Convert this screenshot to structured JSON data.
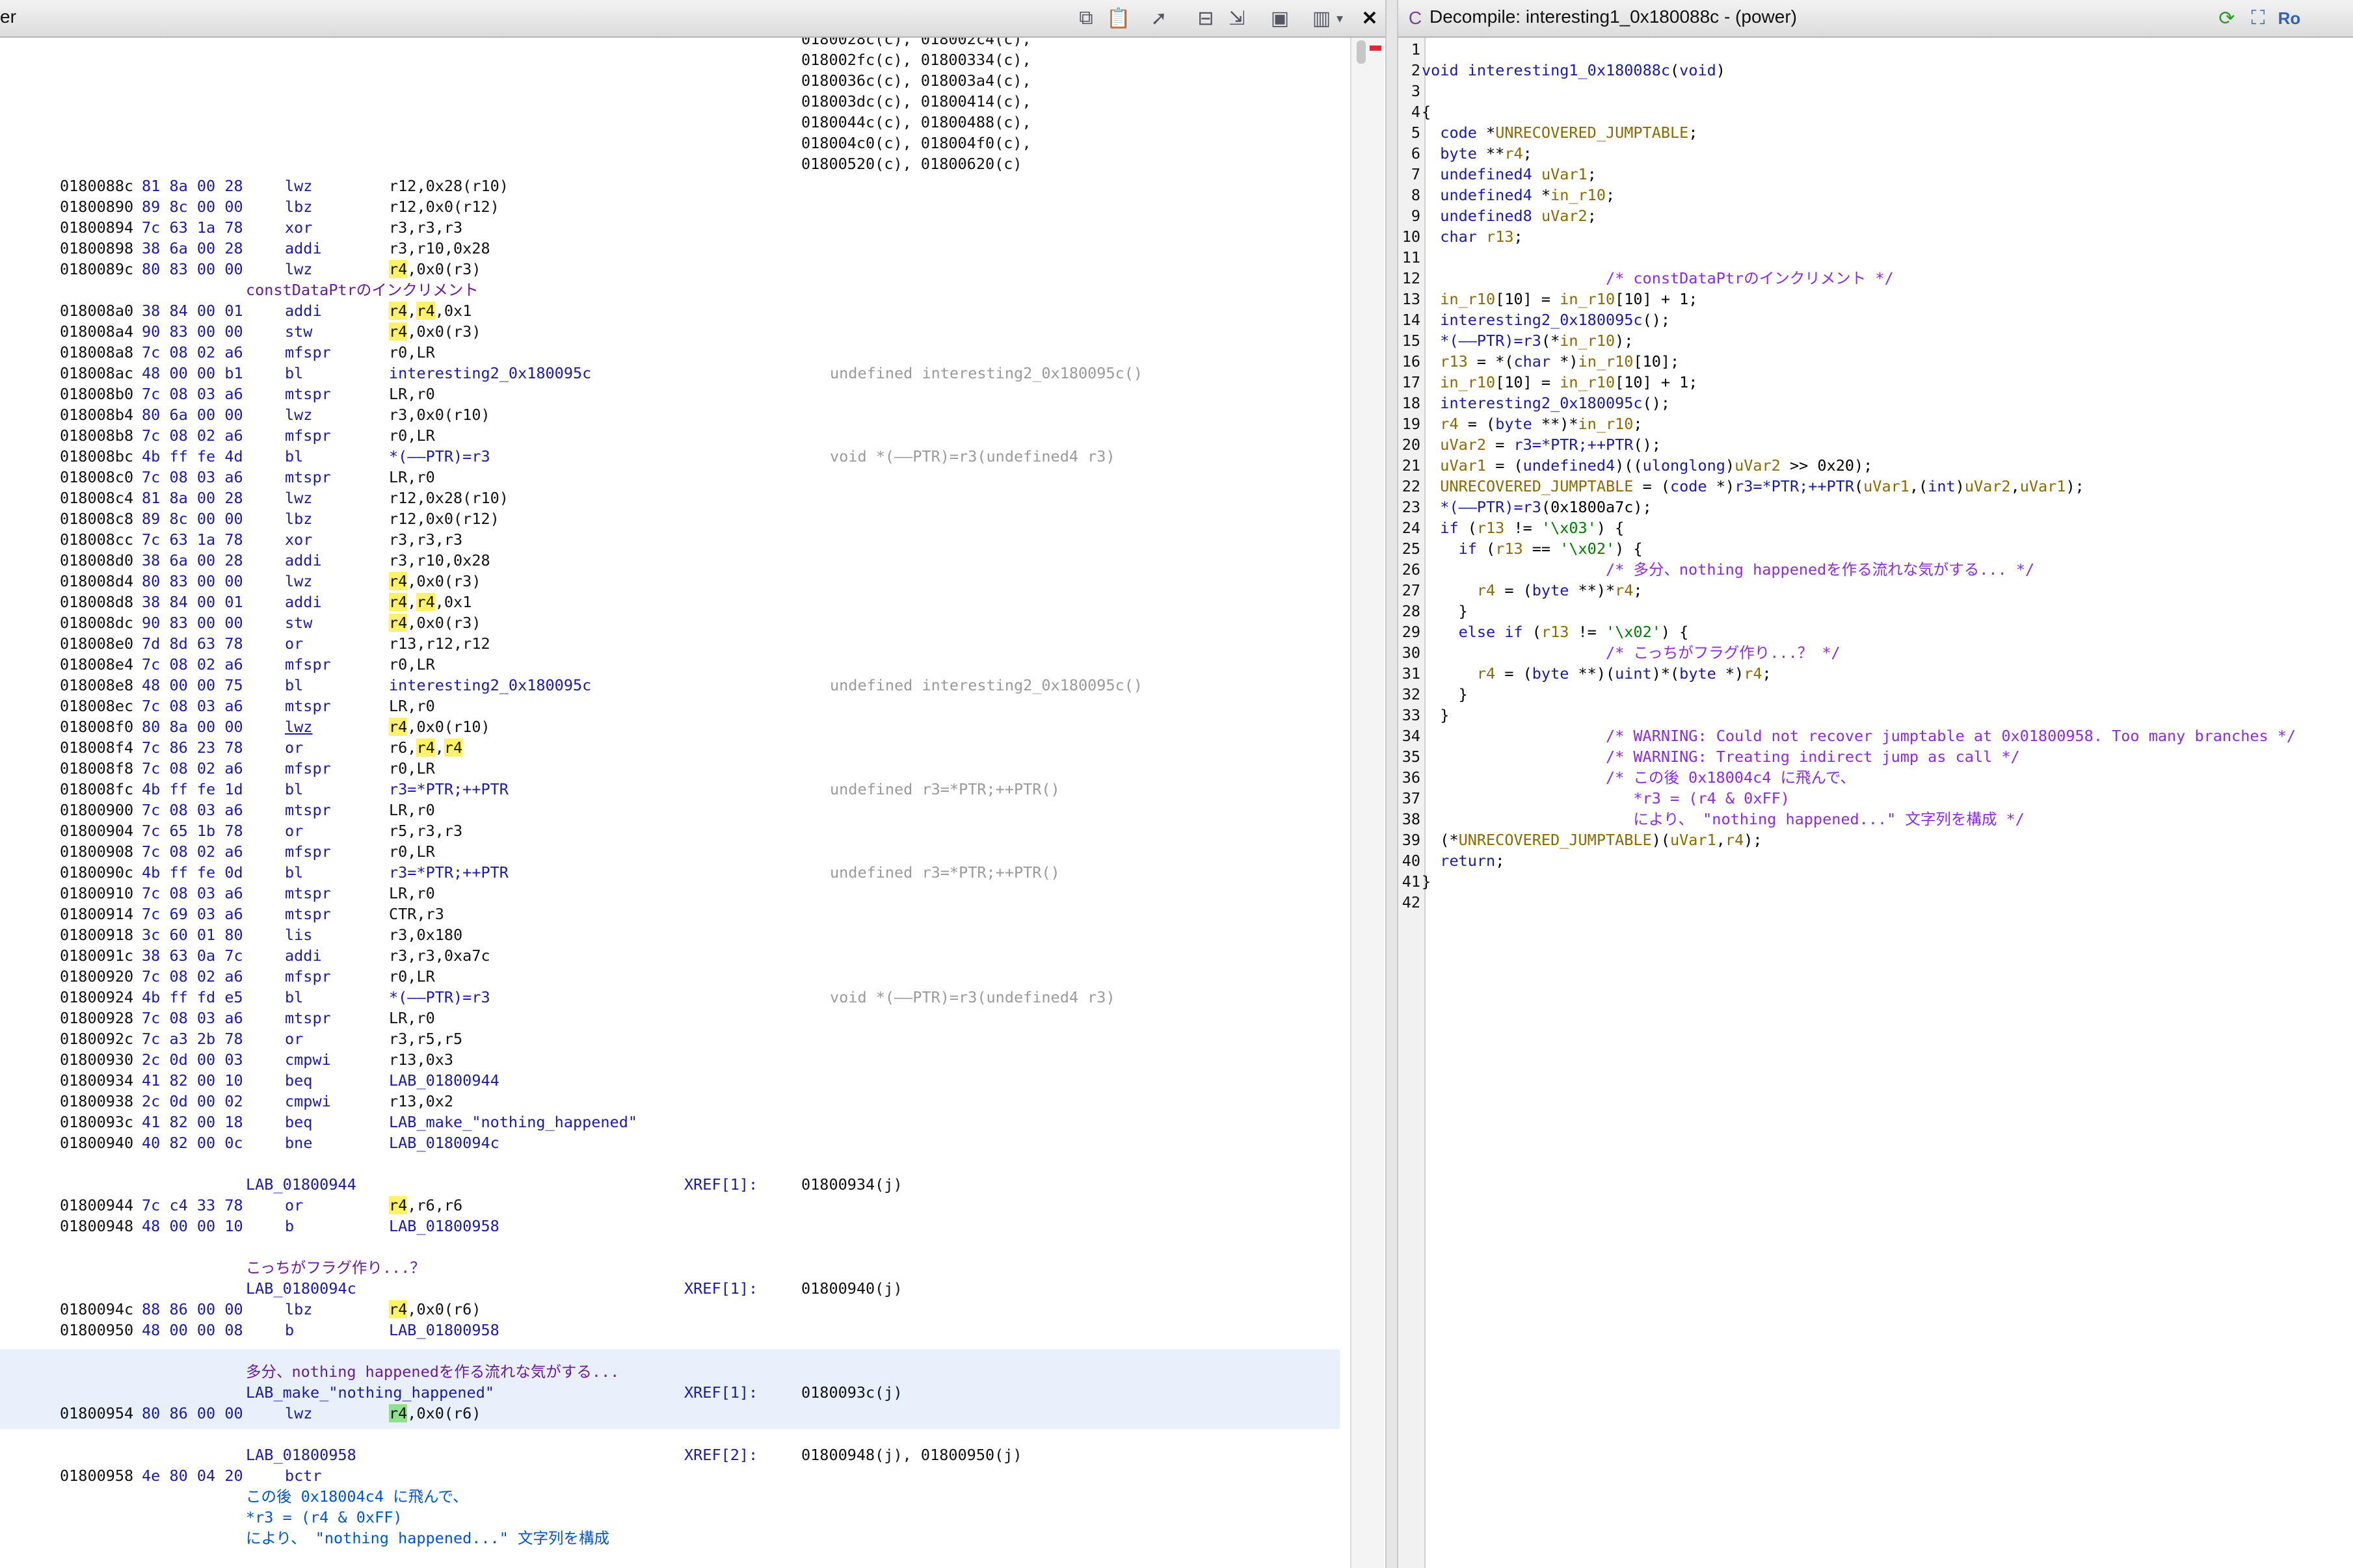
{
  "windows": {
    "listing_title": "er",
    "decompile_title": "Decompile: interesting1_0x180088c -  (power)"
  },
  "listing": {
    "xref_top": [
      "0180028c(c), 018002c4(c),",
      "018002fc(c), 01800334(c),",
      "0180036c(c), 018003a4(c),",
      "018003dc(c), 01800414(c),",
      "0180044c(c), 01800488(c),",
      "018004c0(c), 018004f0(c),",
      "01800520(c), 01800620(c)"
    ],
    "rows": [
      {
        "a": "0180088c",
        "b": "81 8a 00 28",
        "m": "lwz",
        "o": "r12,0x28(r10)"
      },
      {
        "a": "01800890",
        "b": "89 8c 00 00",
        "m": "lbz",
        "o": "r12,0x0(r12)"
      },
      {
        "a": "01800894",
        "b": "7c 63 1a 78",
        "m": "xor",
        "o": "r3,r3,r3"
      },
      {
        "a": "01800898",
        "b": "38 6a 00 28",
        "m": "addi",
        "o": "r3,r10,0x28"
      },
      {
        "a": "0180089c",
        "b": "80 83 00 00",
        "m": "lwz",
        "o": "r4,0x0(r3)"
      },
      {
        "label": "constDataPtrのインクリメント",
        "labelClass": "c-jp"
      },
      {
        "a": "018008a0",
        "b": "38 84 00 01",
        "m": "addi",
        "o": "r4,r4,0x1"
      },
      {
        "a": "018008a4",
        "b": "90 83 00 00",
        "m": "stw",
        "o": "r4,0x0(r3)"
      },
      {
        "a": "018008a8",
        "b": "7c 08 02 a6",
        "m": "mfspr",
        "o": "r0,LR"
      },
      {
        "a": "018008ac",
        "b": "48 00 00 b1",
        "m": "bl",
        "o": "interesting2_0x180095c",
        "c": "undefined interesting2_0x180095c()"
      },
      {
        "a": "018008b0",
        "b": "7c 08 03 a6",
        "m": "mtspr",
        "o": "LR,r0"
      },
      {
        "a": "018008b4",
        "b": "80 6a 00 00",
        "m": "lwz",
        "o": "r3,0x0(r10)"
      },
      {
        "a": "018008b8",
        "b": "7c 08 02 a6",
        "m": "mfspr",
        "o": "r0,LR"
      },
      {
        "a": "018008bc",
        "b": "4b ff fe 4d",
        "m": "bl",
        "o": "*(––PTR)=r3",
        "c": "void *(––PTR)=r3(undefined4 r3)"
      },
      {
        "a": "018008c0",
        "b": "7c 08 03 a6",
        "m": "mtspr",
        "o": "LR,r0"
      },
      {
        "a": "018008c4",
        "b": "81 8a 00 28",
        "m": "lwz",
        "o": "r12,0x28(r10)"
      },
      {
        "a": "018008c8",
        "b": "89 8c 00 00",
        "m": "lbz",
        "o": "r12,0x0(r12)"
      },
      {
        "a": "018008cc",
        "b": "7c 63 1a 78",
        "m": "xor",
        "o": "r3,r3,r3"
      },
      {
        "a": "018008d0",
        "b": "38 6a 00 28",
        "m": "addi",
        "o": "r3,r10,0x28"
      },
      {
        "a": "018008d4",
        "b": "80 83 00 00",
        "m": "lwz",
        "o": "r4,0x0(r3)"
      },
      {
        "a": "018008d8",
        "b": "38 84 00 01",
        "m": "addi",
        "o": "r4,r4,0x1"
      },
      {
        "a": "018008dc",
        "b": "90 83 00 00",
        "m": "stw",
        "o": "r4,0x0(r3)"
      },
      {
        "a": "018008e0",
        "b": "7d 8d 63 78",
        "m": "or",
        "o": "r13,r12,r12"
      },
      {
        "a": "018008e4",
        "b": "7c 08 02 a6",
        "m": "mfspr",
        "o": "r0,LR"
      },
      {
        "a": "018008e8",
        "b": "48 00 00 75",
        "m": "bl",
        "o": "interesting2_0x180095c",
        "c": "undefined interesting2_0x180095c()"
      },
      {
        "a": "018008ec",
        "b": "7c 08 03 a6",
        "m": "mtspr",
        "o": "LR,r0"
      },
      {
        "a": "018008f0",
        "b": "80 8a 00 00",
        "m": "lwz",
        "o": "r4,0x0(r10)"
      },
      {
        "a": "018008f4",
        "b": "7c 86 23 78",
        "m": "or",
        "o": "r6,r4,r4"
      },
      {
        "a": "018008f8",
        "b": "7c 08 02 a6",
        "m": "mfspr",
        "o": "r0,LR"
      },
      {
        "a": "018008fc",
        "b": "4b ff fe 1d",
        "m": "bl",
        "o": "r3=*PTR;++PTR",
        "c": "undefined r3=*PTR;++PTR()"
      },
      {
        "a": "01800900",
        "b": "7c 08 03 a6",
        "m": "mtspr",
        "o": "LR,r0"
      },
      {
        "a": "01800904",
        "b": "7c 65 1b 78",
        "m": "or",
        "o": "r5,r3,r3"
      },
      {
        "a": "01800908",
        "b": "7c 08 02 a6",
        "m": "mfspr",
        "o": "r0,LR"
      },
      {
        "a": "0180090c",
        "b": "4b ff fe 0d",
        "m": "bl",
        "o": "r3=*PTR;++PTR",
        "c": "undefined r3=*PTR;++PTR()"
      },
      {
        "a": "01800910",
        "b": "7c 08 03 a6",
        "m": "mtspr",
        "o": "LR,r0"
      },
      {
        "a": "01800914",
        "b": "7c 69 03 a6",
        "m": "mtspr",
        "o": "CTR,r3"
      },
      {
        "a": "01800918",
        "b": "3c 60 01 80",
        "m": "lis",
        "o": "r3,0x180"
      },
      {
        "a": "0180091c",
        "b": "38 63 0a 7c",
        "m": "addi",
        "o": "r3,r3,0xa7c"
      },
      {
        "a": "01800920",
        "b": "7c 08 02 a6",
        "m": "mfspr",
        "o": "r0,LR"
      },
      {
        "a": "01800924",
        "b": "4b ff fd e5",
        "m": "bl",
        "o": "*(––PTR)=r3",
        "c": "void *(––PTR)=r3(undefined4 r3)"
      },
      {
        "a": "01800928",
        "b": "7c 08 03 a6",
        "m": "mtspr",
        "o": "LR,r0"
      },
      {
        "a": "0180092c",
        "b": "7c a3 2b 78",
        "m": "or",
        "o": "r3,r5,r5"
      },
      {
        "a": "01800930",
        "b": "2c 0d 00 03",
        "m": "cmpwi",
        "o": "r13,0x3"
      },
      {
        "a": "01800934",
        "b": "41 82 00 10",
        "m": "beq",
        "o": "LAB_01800944"
      },
      {
        "a": "01800938",
        "b": "2c 0d 00 02",
        "m": "cmpwi",
        "o": "r13,0x2"
      },
      {
        "a": "0180093c",
        "b": "41 82 00 18",
        "m": "beq",
        "o": "LAB_make_\"nothing_happened\""
      },
      {
        "a": "01800940",
        "b": "40 82 00 0c",
        "m": "bne",
        "o": "LAB_0180094c"
      },
      {
        "blank": true
      },
      {
        "label": "LAB_01800944",
        "labelClass": "c-lbl",
        "xref": "XREF[1]:",
        "xaddr": "01800934(j)"
      },
      {
        "a": "01800944",
        "b": "7c c4 33 78",
        "m": "or",
        "o": "r4,r6,r6"
      },
      {
        "a": "01800948",
        "b": "48 00 00 10",
        "m": "b",
        "o": "LAB_01800958"
      },
      {
        "blank": true
      },
      {
        "label": "こっちがフラグ作り...？",
        "labelClass": "c-jp"
      },
      {
        "label": "LAB_0180094c",
        "labelClass": "c-lbl",
        "xref": "XREF[1]:",
        "xaddr": "01800940(j)"
      },
      {
        "a": "0180094c",
        "b": "88 86 00 00",
        "m": "lbz",
        "o": "r4,0x0(r6)"
      },
      {
        "a": "01800950",
        "b": "48 00 00 08",
        "m": "b",
        "o": "LAB_01800958"
      },
      {
        "blank": true
      },
      {
        "label": "多分、nothing happenedを作る流れな気がする...",
        "labelClass": "c-jp"
      },
      {
        "label": "LAB_make_\"nothing_happened\"",
        "labelClass": "c-lbl",
        "xref": "XREF[1]:",
        "xaddr": "0180093c(j)"
      },
      {
        "a": "01800954",
        "b": "80 86 00 00",
        "m": "lwz",
        "o": "r4,0x0(r6)"
      },
      {
        "blank": true
      },
      {
        "label": "LAB_01800958",
        "labelClass": "c-lbl",
        "xref": "XREF[2]:",
        "xaddr": "01800948(j), 01800950(j)"
      },
      {
        "a": "01800958",
        "b": "4e 80 04 20",
        "m": "bctr",
        "o": ""
      },
      {
        "label": "この後 0x18004c4 に飛んで、",
        "labelClass": "c-blue"
      },
      {
        "label": "*r3 = (r4 & 0xFF)",
        "labelClass": "c-blue"
      },
      {
        "label": "により、 \"nothing happened...\" 文字列を構成",
        "labelClass": "c-blue"
      }
    ]
  },
  "decompile": {
    "lines": [
      "",
      "void interesting1_0x180088c(void)",
      "",
      "{",
      "  code *UNRECOVERED_JUMPTABLE;",
      "  byte **r4;",
      "  undefined4 uVar1;",
      "  undefined4 *in_r10;",
      "  undefined8 uVar2;",
      "  char r13;",
      "",
      "                    /* constDataPtrのインクリメント */",
      "  in_r10[10] = in_r10[10] + 1;",
      "  interesting2_0x180095c();",
      "  *(––PTR)=r3(*in_r10);",
      "  r13 = *(char *)in_r10[10];",
      "  in_r10[10] = in_r10[10] + 1;",
      "  interesting2_0x180095c();",
      "  r4 = (byte **)*in_r10;",
      "  uVar2 = r3=*PTR;++PTR();",
      "  uVar1 = (undefined4)((ulonglong)uVar2 >> 0x20);",
      "  UNRECOVERED_JUMPTABLE = (code *)r3=*PTR;++PTR(uVar1,(int)uVar2,uVar1);",
      "  *(––PTR)=r3(0x1800a7c);",
      "  if (r13 != '\\x03') {",
      "    if (r13 == '\\x02') {",
      "                    /* 多分、nothing happenedを作る流れな気がする... */",
      "      r4 = (byte **)*r4;",
      "    }",
      "    else if (r13 != '\\x02') {",
      "                    /* こっちがフラグ作り...？ */",
      "      r4 = (byte **)(uint)*(byte *)r4;",
      "    }",
      "  }",
      "                    /* WARNING: Could not recover jumptable at 0x01800958. Too many branches */",
      "                    /* WARNING: Treating indirect jump as call */",
      "                    /* この後 0x18004c4 に飛んで、",
      "                       *r3 = (r4 & 0xFF)",
      "                       により、 \"nothing happened...\" 文字列を構成 */",
      "  (*UNRECOVERED_JUMPTABLE)(uVar1,r4);",
      "  return;",
      "}",
      ""
    ]
  },
  "colors": {
    "blue": "#1a1aa6",
    "comment_purple": "#8a2be2",
    "highlight_yellow": "#fff266",
    "highlight_green": "#8fe08f",
    "selected_block": "#e8f0fb"
  }
}
